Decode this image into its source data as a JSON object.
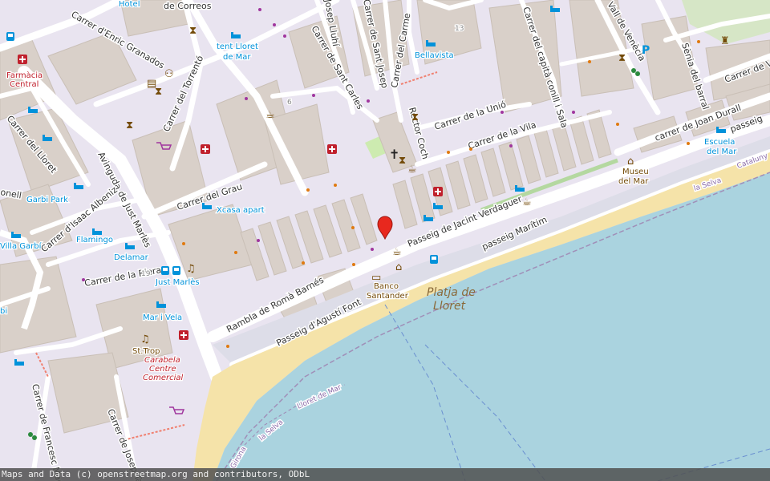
{
  "map": {
    "attribution": "Maps and Data (c) openstreetmap.org and contributors, ODbL",
    "colors": {
      "sea": "#aad3df",
      "beach": "#f5e3a9",
      "land": "#e9e4f0",
      "building": "#d9d0c9",
      "road": "#ffffff",
      "promenade": "#dddde8",
      "park": "#c8facc",
      "health": "#c0202c",
      "accommodation": "#0092da",
      "amenity": "#734a08"
    },
    "streets": {
      "enric_granados": "Carrer d'Enric Granados",
      "torrento": "Carrer del Torrentó",
      "lloret": "Carrer del Lloret",
      "just_marles": "Avinguda de Just Marlès",
      "isaac_albeniz": "Carrer d'Isaac Albeniz",
      "grau": "Carrer del Grau",
      "riera": "Carrer de la Riera",
      "roma_barnes": "Rambla de Romà Barnés",
      "agusti_font": "Passeig d'Agustí Font",
      "jacint_verdaguer": "Passeig de Jacint Verdaguer",
      "maritim": "passeig Marítim",
      "vila": "Carrer de la Vila",
      "unio": "Carrer de la Unió",
      "sant_carles": "Carrer de Sant Carles",
      "josep_lluhi": "Josep Lluhí",
      "sant_josep": "Carrer de Sant Josep",
      "carme": "Carrer del Carme",
      "rector_coch": "Rector Coch",
      "capita_conill": "Carrer del capità conill i Sala",
      "venecia": "Vall de Venècia",
      "senia_barral": "Sènia del barral",
      "joan_durall": "carrer de Joan Durall",
      "verge": "Carrer de Ve",
      "passeig_edge": "passeig",
      "francesc_macia": "Carrer de Francesc Macià",
      "josep_tarrad": "Carrer de Josep Tarrad",
      "onell": "onell",
      "lloret_de_mar": "Lloret de Mar",
      "la_selva": "la Selva",
      "la_selva_2": "la Selva",
      "catalunya": "Cataluny",
      "girona": "Girona",
      "correos": "de Correos"
    },
    "labels": {
      "hotel": "Hotel",
      "farmacia_1": "Farmàcia",
      "farmacia_2": "Central",
      "tent_1": "tent Lloret",
      "tent_2": "de Mar",
      "bellavista": "Bellavista",
      "garbi_park": "Garbi Park",
      "xcasa": "Xcasa apart",
      "flamingo": "Flamingo",
      "delamar": "Delamar",
      "just_marles_poi": "Just Marlès",
      "mar_i_vela": "Mar i Vela",
      "sttrop": "St.Trop",
      "carabela_1": "Carabela",
      "carabela_2": "Centre",
      "carabela_3": "Comercial",
      "villa_garbi": "Villa Garbí",
      "bi": "bi",
      "banco_1": "Banco",
      "banco_2": "Santander",
      "museu_1": "Museu",
      "museu_2": "del Mar",
      "escuela_1": "Escuela",
      "escuela_2": "del Mar",
      "platja_1": "Platja de",
      "platja_2": "Lloret",
      "house_6": "6",
      "house_13": "13",
      "house_19": "19"
    },
    "icons": {
      "marker": "map-pin-icon",
      "cross": "church-cross-glyph",
      "parking": "P"
    }
  }
}
